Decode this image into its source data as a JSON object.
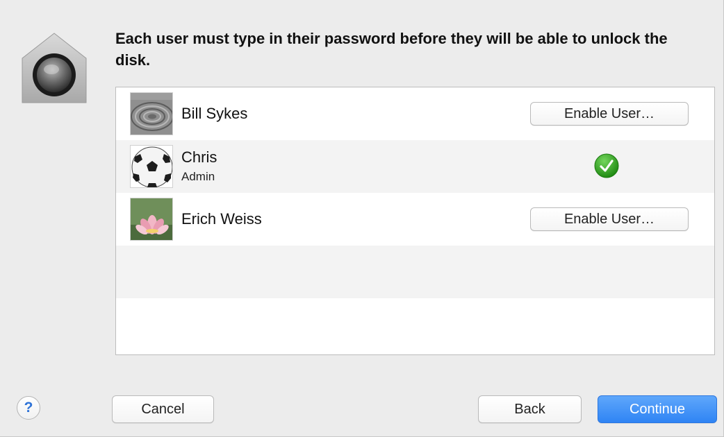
{
  "dialog": {
    "headline": "Each user must type in their password before they will be able to unlock the disk.",
    "icon": "filevault-house-lock-icon"
  },
  "users": [
    {
      "name": "Bill Sykes",
      "role": "",
      "avatar": "zen-garden-ripples-avatar",
      "status": "disabled",
      "action_label": "Enable User…"
    },
    {
      "name": "Chris",
      "role": "Admin",
      "avatar": "soccer-ball-avatar",
      "status": "enabled",
      "action_label": ""
    },
    {
      "name": "Erich Weiss",
      "role": "",
      "avatar": "lotus-flower-avatar",
      "status": "disabled",
      "action_label": "Enable User…"
    }
  ],
  "footer": {
    "help_label": "?",
    "cancel_label": "Cancel",
    "back_label": "Back",
    "continue_label": "Continue"
  },
  "colors": {
    "accent": "#2f84f4",
    "check_green": "#2ea41c",
    "sheet_bg": "#ececec",
    "help_blue": "#2f73d7"
  }
}
